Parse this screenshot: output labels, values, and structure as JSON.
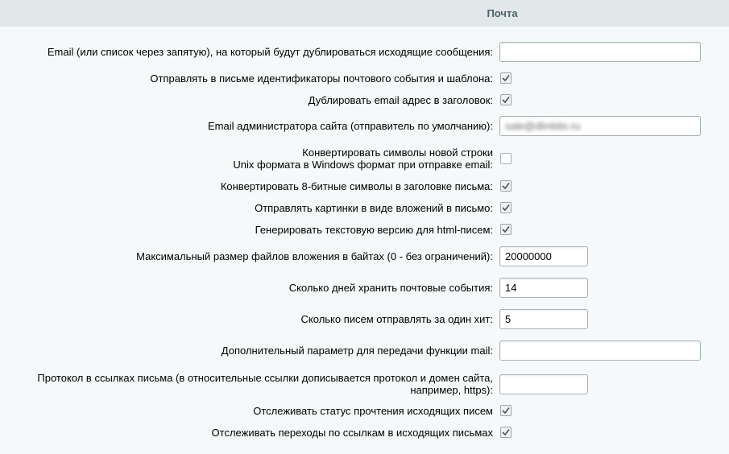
{
  "section": {
    "title": "Почта"
  },
  "fields": [
    {
      "label": "Email (или список через запятую), на который будут дублироваться исходящие сообщения:",
      "type": "text",
      "value": ""
    },
    {
      "label": "Отправлять в письме идентификаторы почтового события и шаблона:",
      "type": "checkbox",
      "checked": true
    },
    {
      "label": "Дублировать email адрес в заголовок:",
      "type": "checkbox",
      "checked": true
    },
    {
      "label": "Email администратора сайта (отправитель по умолчанию):",
      "type": "text",
      "value": "sale@dlmbits.ru"
    },
    {
      "label_line1": "Конвертировать символы новой строки",
      "label_line2": "Unix формата в Windows формат при отправке email:",
      "type": "checkbox",
      "checked": false
    },
    {
      "label": "Конвертировать 8-битные символы в заголовке письма:",
      "type": "checkbox",
      "checked": true
    },
    {
      "label": "Отправлять картинки в виде вложений в письмо:",
      "type": "checkbox",
      "checked": true
    },
    {
      "label": "Генерировать текстовую версию для html-писем:",
      "type": "checkbox",
      "checked": true
    },
    {
      "label": "Максимальный размер файлов вложения в байтах (0 - без ограничений):",
      "type": "text",
      "value": "20000000"
    },
    {
      "label": "Сколько дней хранить почтовые события:",
      "type": "text",
      "value": "14"
    },
    {
      "label": "Сколько писем отправлять за один хит:",
      "type": "text",
      "value": "5"
    },
    {
      "label": "Дополнительный параметр для передачи функции mail:",
      "type": "text",
      "value": ""
    },
    {
      "label_line1": "Протокол в ссылках письма (в относительные ссылки дописывается протокол и домен сайта,",
      "label_line2": "например, https):",
      "type": "text",
      "value": ""
    },
    {
      "label": "Отслеживать статус прочтения исходящих писем",
      "type": "checkbox",
      "checked": true
    },
    {
      "label": "Отслеживать переходы по ссылкам в исходящих письмах",
      "type": "checkbox",
      "checked": true
    }
  ]
}
